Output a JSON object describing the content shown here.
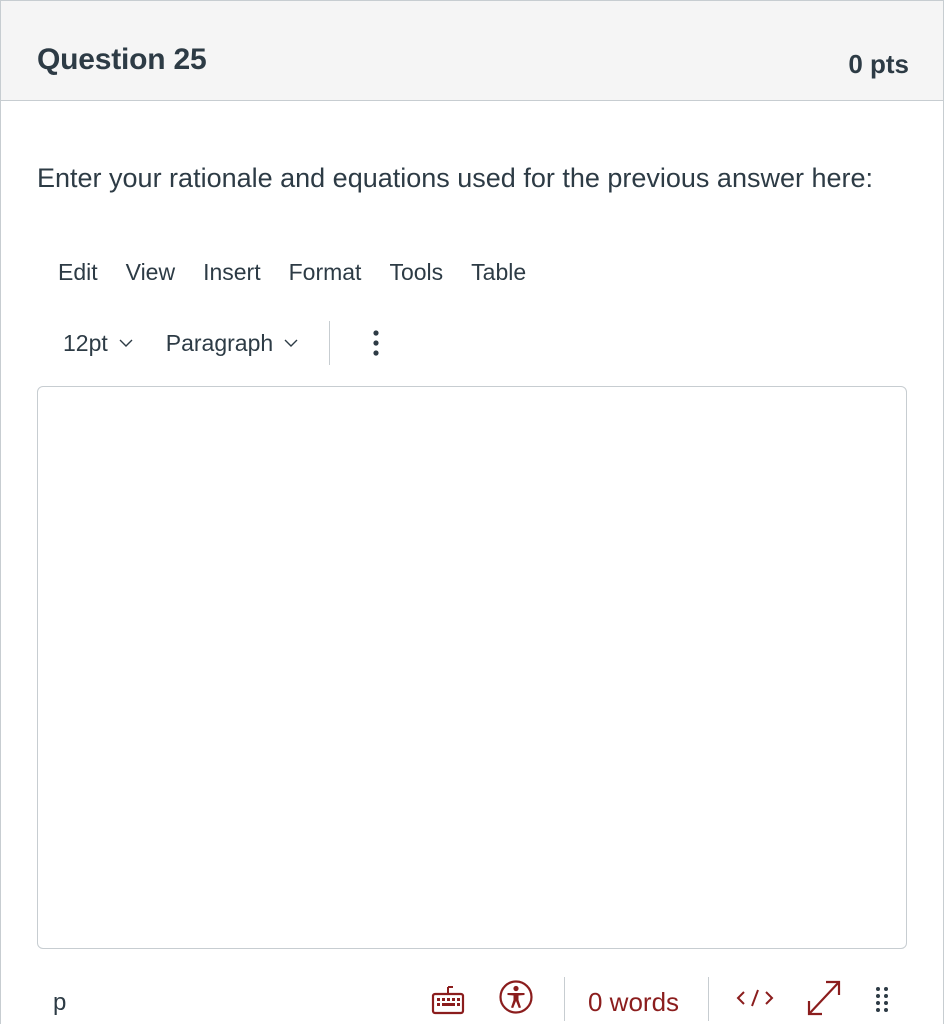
{
  "question": {
    "title": "Question 25",
    "points": "0 pts",
    "prompt": "Enter your rationale and equations used for the previous answer here:"
  },
  "editor": {
    "menubar": [
      "Edit",
      "View",
      "Insert",
      "Format",
      "Tools",
      "Table"
    ],
    "toolbar": {
      "font_size": "12pt",
      "block_format": "Paragraph",
      "more_icon": "vertical-ellipsis-icon"
    },
    "content": "",
    "statusbar": {
      "path": "p",
      "word_count": "0 words",
      "icons": [
        "keyboard-icon",
        "accessibility-icon",
        "html-code-icon",
        "fullscreen-icon",
        "resize-handle-icon"
      ]
    }
  },
  "colors": {
    "accent": "#8b1d1d",
    "text": "#2d3b45",
    "border": "#c7cdd1",
    "header_bg": "#f5f5f5"
  }
}
